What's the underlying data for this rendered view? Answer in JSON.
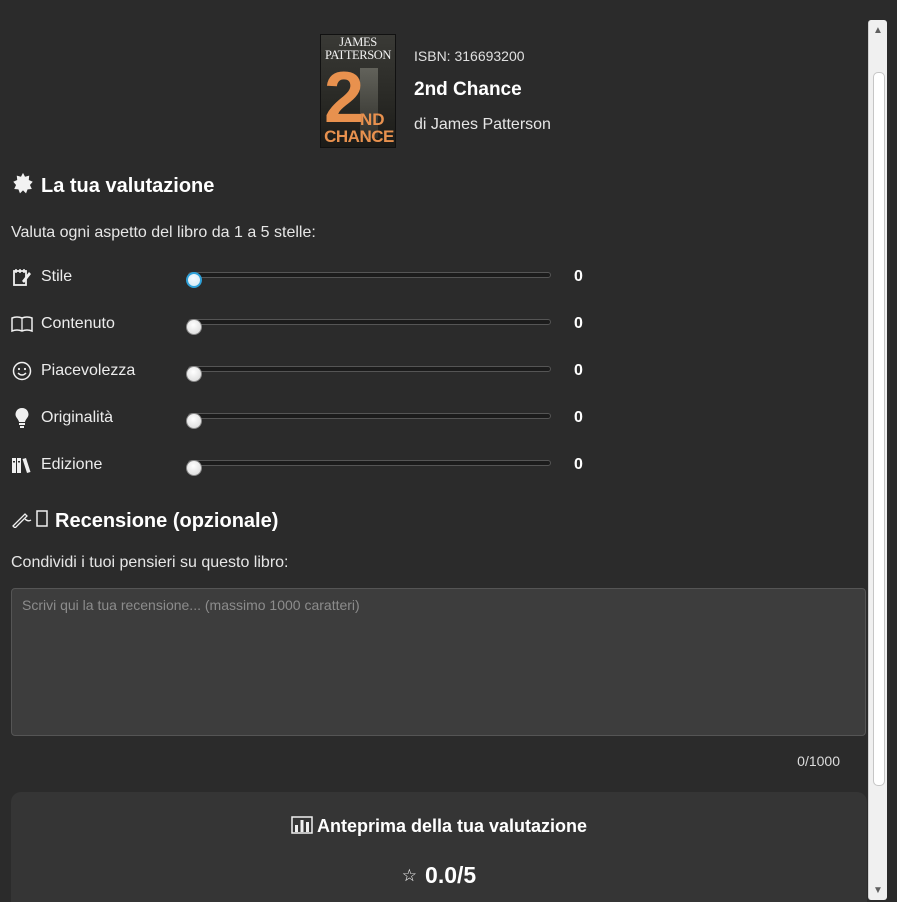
{
  "book": {
    "isbn_label": "ISBN: 316693200",
    "title": "2nd Chance",
    "author_line": "di James Patterson",
    "cover": {
      "author_top": "JAMES",
      "author_bottom": "PATTERSON",
      "big_number": "2",
      "suffix": "ND",
      "word": "CHANCE"
    }
  },
  "rating_section": {
    "icon": "badge-star-icon",
    "title": "La tua valutazione",
    "instructions": "Valuta ogni aspetto del libro da 1 a 5 stelle:",
    "max": 5,
    "items": [
      {
        "label": "Stile",
        "icon": "notepad-pencil-icon",
        "value": 0,
        "display": "0"
      },
      {
        "label": "Contenuto",
        "icon": "open-book-icon",
        "value": 0,
        "display": "0"
      },
      {
        "label": "Piacevolezza",
        "icon": "smiley-icon",
        "value": 0,
        "display": "0"
      },
      {
        "label": "Originalità",
        "icon": "lightbulb-icon",
        "value": 0,
        "display": "0"
      },
      {
        "label": "Edizione",
        "icon": "books-icon",
        "value": 0,
        "display": "0"
      }
    ]
  },
  "review_section": {
    "icon": "writing-hand-icon",
    "title": "Recensione (opzionale)",
    "prompt": "Condividi i tuoi pensieri su questo libro:",
    "placeholder": "Scrivi qui la tua recensione... (massimo 1000 caratteri)",
    "value": "",
    "char_count": "0/1000"
  },
  "preview": {
    "icon": "bar-chart-icon",
    "title": "Anteprima della tua valutazione",
    "star_icon": "star-icon",
    "score": "0.0/5"
  },
  "colors": {
    "background": "#2b2b2b",
    "cover_accent": "#e8914e",
    "focus_ring": "#2ea0d8"
  }
}
